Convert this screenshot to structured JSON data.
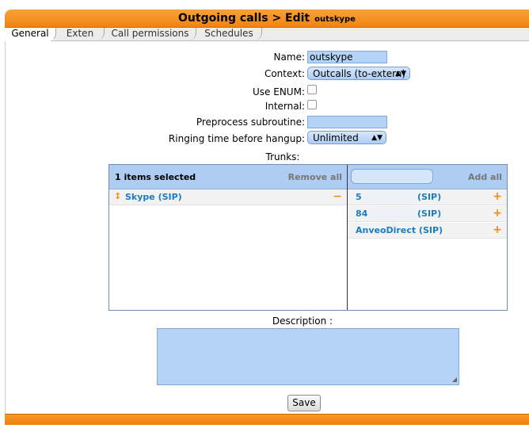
{
  "header": {
    "title": "Outgoing calls > Edit",
    "subtitle": "outskype"
  },
  "tabs": [
    {
      "label": "General",
      "active": true
    },
    {
      "label": "Exten",
      "active": false
    },
    {
      "label": "Call permissions",
      "active": false
    },
    {
      "label": "Schedules",
      "active": false
    }
  ],
  "form": {
    "name_label": "Name:",
    "name_value": "outskype",
    "context_label": "Context:",
    "context_value": "Outcalls (to-extern)",
    "use_enum_label": "Use ENUM:",
    "use_enum_checked": false,
    "internal_label": "Internal:",
    "internal_checked": false,
    "preprocess_label": "Preprocess subroutine:",
    "preprocess_value": "",
    "ringing_label": "Ringing time before hangup:",
    "ringing_value": "Unlimited",
    "trunks_label": "Trunks:",
    "description_label": "Description :",
    "description_value": "",
    "save_label": "Save"
  },
  "trunks": {
    "selected_header": "1 items selected",
    "remove_all_label": "Remove all",
    "add_all_label": "Add all",
    "search_value": "",
    "selected": [
      {
        "name": "Skype (SIP)",
        "op": "−",
        "move": "↕"
      }
    ],
    "available": [
      {
        "prefix": "5",
        "suffix": "(SIP)",
        "op": "+"
      },
      {
        "prefix": "84",
        "suffix": "(SIP)",
        "op": "+"
      },
      {
        "name": "AnveoDirect (SIP)",
        "op": "+"
      }
    ]
  },
  "colors": {
    "accent": "#f08c0c",
    "field_bg": "#b4d3f7",
    "link": "#1c7cbf"
  }
}
